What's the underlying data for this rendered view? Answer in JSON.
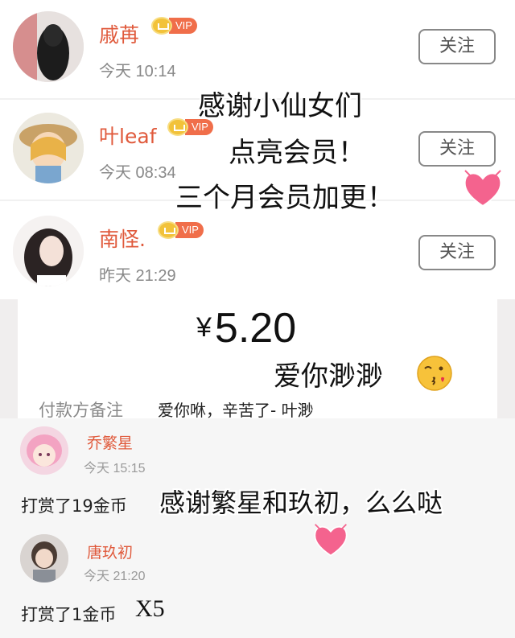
{
  "follow_list": [
    {
      "name": "戚苒",
      "vip": "VIP",
      "time": "今天 10:14",
      "button": "关注"
    },
    {
      "name": "叶leaf",
      "vip": "VIP",
      "time": "今天 08:34",
      "button": "关注"
    },
    {
      "name": "南怪.",
      "vip": "VIP",
      "time": "昨天 21:29",
      "button": "关注"
    }
  ],
  "caption": {
    "line1": "感谢小仙女们",
    "line2": "点亮会员！",
    "line3": "三个月会员加更！"
  },
  "payment": {
    "currency": "¥",
    "amount": "5.20",
    "caption": "爱你渺渺",
    "memo_label": "付款方备注",
    "memo_value": "爱你咻，辛苦了- 叶渺"
  },
  "rewards": [
    {
      "name": "乔繁星",
      "time": "今天 15:15",
      "text": "打赏了19金币"
    },
    {
      "name": "唐玖初",
      "time": "今天 21:20",
      "text": "打赏了1金币"
    }
  ],
  "reward_caption": "感谢繁星和玖初，么么哒",
  "reward_multiplier": "X5",
  "colors": {
    "name": "#e05a3c",
    "vip_badge": "#f06e4a",
    "heart": "#f4638e"
  }
}
